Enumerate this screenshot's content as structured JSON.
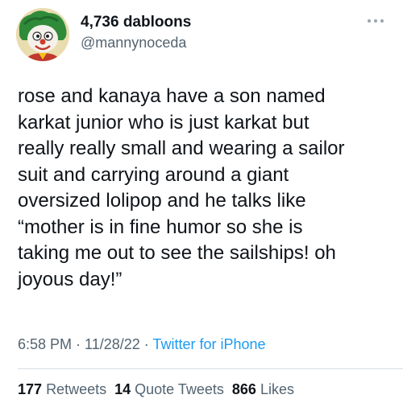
{
  "user": {
    "display_name": "4,736 dabloons",
    "handle": "@mannynoceda",
    "avatar_icon": "clown-character-avatar"
  },
  "more_icon": "ellipsis-icon",
  "tweet": {
    "lines": [
      "rose and kanaya have a son named",
      "karkat junior who is just karkat but",
      "really really small and wearing a sailor",
      "suit and carrying around a giant",
      "oversized lolipop and he talks like",
      "“mother is in fine humor so she is",
      "taking me out to see the sailships! oh",
      "joyous day!”"
    ]
  },
  "meta": {
    "time": "6:58 PM",
    "sep1": " · ",
    "date": "11/28/22",
    "sep2": " · ",
    "source": "Twitter for iPhone"
  },
  "stats": {
    "retweets_count": "177",
    "retweets_label": "Retweets",
    "quotes_count": "14",
    "quotes_label": "Quote Tweets",
    "likes_count": "866",
    "likes_label": "Likes"
  },
  "colors": {
    "text": "#0f1419",
    "secondary": "#536471",
    "link": "#1d9bf0",
    "divider": "#d9dee2"
  }
}
